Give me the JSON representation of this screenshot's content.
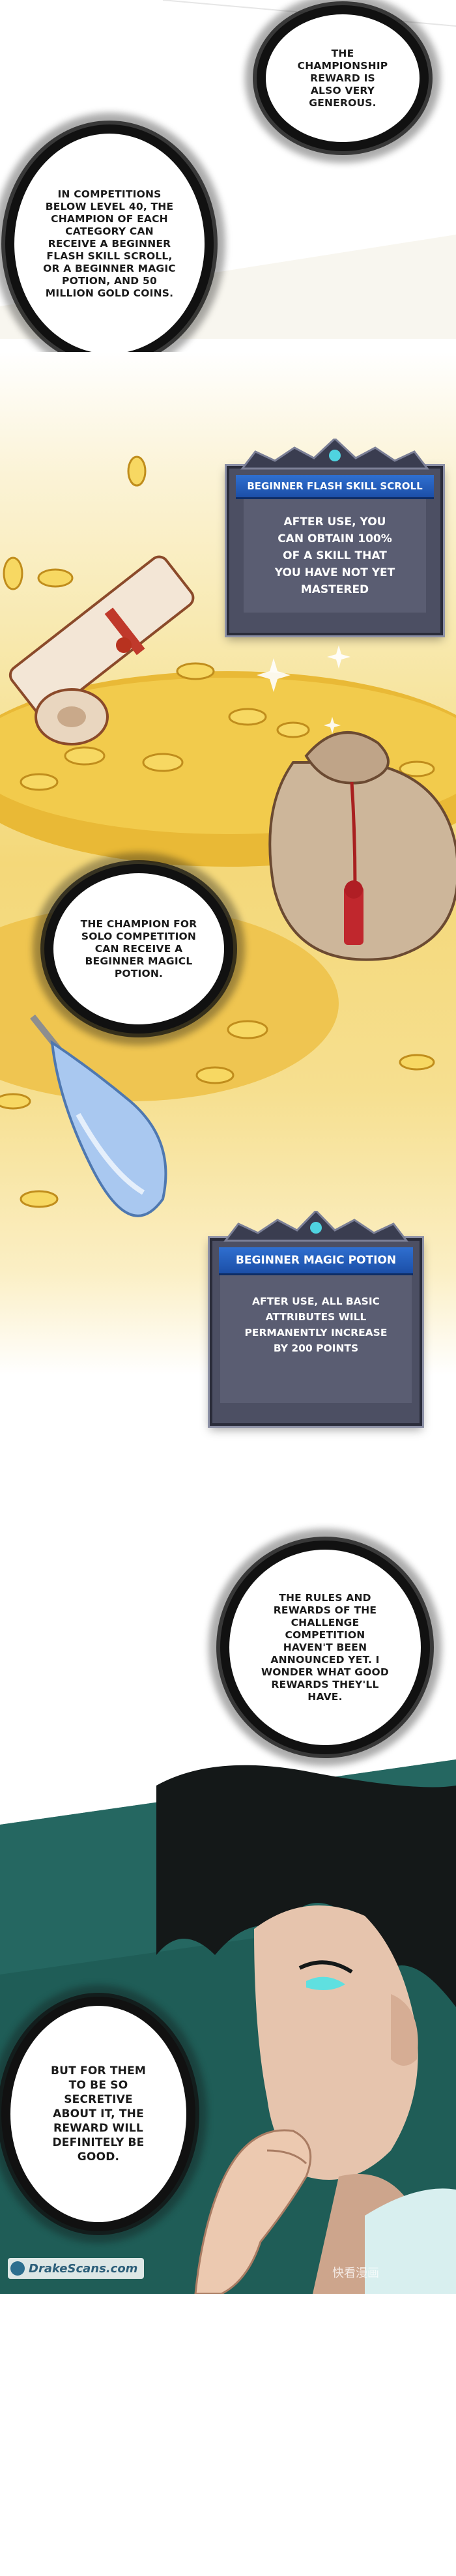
{
  "bubbles": {
    "championship_reward": "The championship reward is also very generous.",
    "competitions_below_40": "In competitions below level 40, the champion of each category can receive a beginner flash skill scroll, or a beginner magic potion, and 50 million gold coins.",
    "solo_champion": "The champion for solo competition can receive a beginner magicl potion.",
    "rules_unannounced": "The rules and rewards of the challenge competition haven't been announced yet. I wonder what good rewards they'll have.",
    "secretive": "But for them to be so secretive about it, the reward will definitely be good."
  },
  "system_windows": {
    "flash_scroll": {
      "title": "Beginner flash skill scroll",
      "body": "After use, you can obtain 100% of a skill that you have not yet mastered"
    },
    "magic_potion": {
      "title": "Beginner magic potion",
      "body": "After use, all basic attributes will permanently increase by 200 points"
    }
  },
  "watermarks": {
    "site": "DrakeScans.com",
    "logo": "快看漫画"
  },
  "colors": {
    "gold": "#e8b93a",
    "system_title": "#2f6fd0",
    "system_bg": "#4c4f63",
    "teal": "#1f5d57"
  }
}
